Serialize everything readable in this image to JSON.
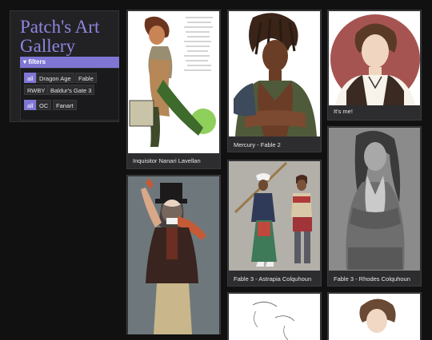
{
  "site": {
    "title": "Patch's Art Gallery"
  },
  "filters": {
    "header_label": "▾ filters",
    "group1": [
      "all",
      "Dragon Age",
      "Fable",
      "RWBY",
      "Baldur's Gate 3"
    ],
    "group2": [
      "all",
      "OC",
      "Fanart"
    ],
    "accent_color": "#7f76d4"
  },
  "gallery": {
    "cards": [
      {
        "caption": "Inquisitor Nanari Lavellan"
      },
      {
        "caption": "Mercury - Fable 2"
      },
      {
        "caption": "It's me!"
      },
      {
        "caption": "Fable 3 - Astrapia Colquhoun"
      },
      {
        "caption": "Fable 3 - Rhodes Colquhoun"
      },
      {
        "caption": ""
      },
      {
        "caption": ""
      },
      {
        "caption": ""
      }
    ]
  }
}
